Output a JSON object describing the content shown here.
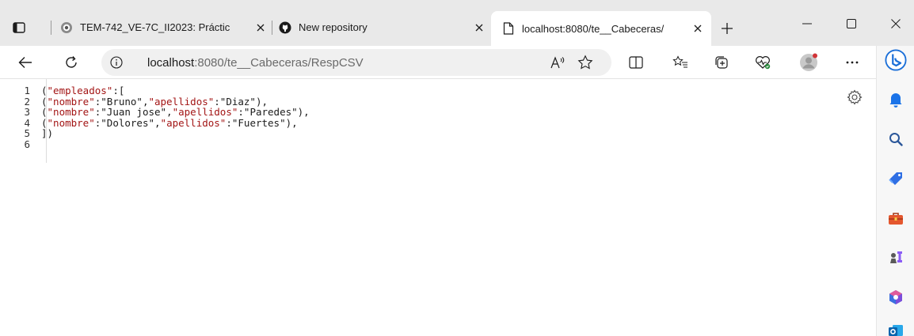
{
  "tabs": [
    {
      "title": "TEM-742_VE-7C_II2023: Práctic",
      "favicon": "moodle-icon",
      "close": "✕",
      "active": false
    },
    {
      "title": "New repository",
      "favicon": "github-icon",
      "close": "✕",
      "active": false
    },
    {
      "title": "localhost:8080/te__Cabeceras/",
      "favicon": "page-icon",
      "close": "✕",
      "active": true
    }
  ],
  "window": {
    "minimize": "—",
    "maximize": "☐",
    "close": "✕"
  },
  "address_bar": {
    "host": "localhost",
    "path": ":8080/te__Cabeceras/RespCSV"
  },
  "toolbar_icons": [
    "back-icon",
    "refresh-icon",
    "read-aloud-icon",
    "favorite-star-icon",
    "split-screen-icon",
    "favorites-icon",
    "collections-icon",
    "browser-essentials-icon",
    "profile-icon",
    "more-icon",
    "copilot-icon"
  ],
  "code_lines": [
    {
      "n": "1",
      "parts": [
        {
          "t": "(",
          "c": "str"
        },
        {
          "t": "\"empleados\"",
          "c": "key"
        },
        {
          "t": ":[",
          "c": "str"
        }
      ]
    },
    {
      "n": "2",
      "parts": [
        {
          "t": "(",
          "c": "str"
        },
        {
          "t": "\"nombre\"",
          "c": "key"
        },
        {
          "t": ":\"Bruno\",",
          "c": "str"
        },
        {
          "t": "\"apellidos\"",
          "c": "key"
        },
        {
          "t": ":\"Diaz\"),",
          "c": "str"
        }
      ]
    },
    {
      "n": "3",
      "parts": [
        {
          "t": "(",
          "c": "str"
        },
        {
          "t": "\"nombre\"",
          "c": "key"
        },
        {
          "t": ":\"Juan jose\",",
          "c": "str"
        },
        {
          "t": "\"apellidos\"",
          "c": "key"
        },
        {
          "t": ":\"Paredes\"),",
          "c": "str"
        }
      ]
    },
    {
      "n": "4",
      "parts": [
        {
          "t": "(",
          "c": "str"
        },
        {
          "t": "\"nombre\"",
          "c": "key"
        },
        {
          "t": ":\"Dolores\",",
          "c": "str"
        },
        {
          "t": "\"apellidos\"",
          "c": "key"
        },
        {
          "t": ":\"Fuertes\"),",
          "c": "str"
        }
      ]
    },
    {
      "n": "5",
      "parts": [
        {
          "t": "])",
          "c": "str"
        }
      ]
    },
    {
      "n": "6",
      "parts": []
    }
  ],
  "sidebar_icons": [
    "notifications-icon",
    "search-icon",
    "shopping-tag-icon",
    "tools-briefcase-icon",
    "games-icon",
    "office-icon",
    "outlook-icon"
  ],
  "colors": {
    "accent": "#0078d4",
    "key_string": "#a31515",
    "tab_strip": "#e9e9e9"
  }
}
